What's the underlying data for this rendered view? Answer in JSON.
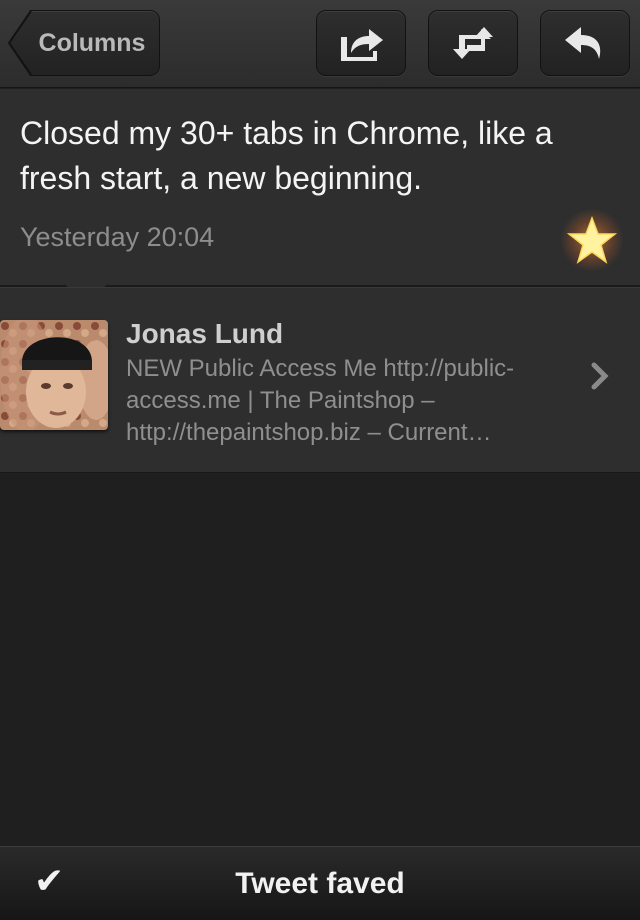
{
  "navbar": {
    "back_label": "Columns",
    "buttons": [
      {
        "icon": "share-icon"
      },
      {
        "icon": "retweet-icon"
      },
      {
        "icon": "reply-icon"
      }
    ]
  },
  "tweet": {
    "text": "Closed my 30+ tabs in Chrome, like a fresh start, a new beginning.",
    "time": "Yesterday 20:04",
    "favorited": true,
    "star_color": "#fff3a0"
  },
  "user": {
    "name": "Jonas Lund",
    "bio": "NEW Public Access Me http://public-access.me | The Paintshop – http://thepaintshop.biz – Current…"
  },
  "toast": {
    "icon": "checkmark-icon",
    "message": "Tweet faved"
  },
  "colors": {
    "background": "#1f1f1f",
    "panel": "#2e2e2e",
    "text_primary": "#f4f4f4",
    "text_secondary": "#8d8d8d"
  }
}
